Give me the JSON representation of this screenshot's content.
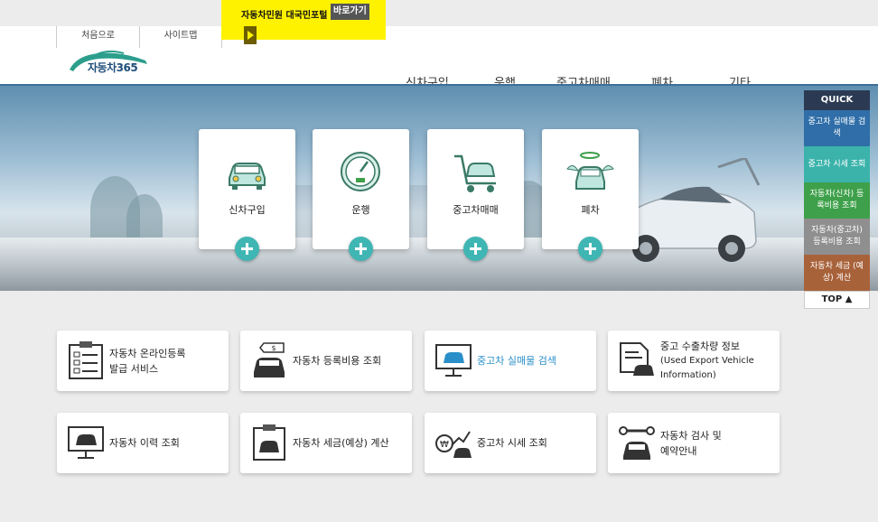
{
  "utility": {
    "home": "처음으로",
    "sitemap": "사이트맵"
  },
  "promo": {
    "text": "자동차민원 대국민포털",
    "button": "바로가기"
  },
  "logo": {
    "text": "자동차365"
  },
  "gnb": [
    "신차구입",
    "운행",
    "중고차매매",
    "폐차",
    "기타"
  ],
  "cards": [
    {
      "label": "신차구입",
      "icon": "new-car-icon"
    },
    {
      "label": "운행",
      "icon": "speedometer-icon"
    },
    {
      "label": "중고차매매",
      "icon": "cart-car-icon"
    },
    {
      "label": "폐차",
      "icon": "angel-car-icon"
    }
  ],
  "quick": {
    "title": "QUICK",
    "items": [
      {
        "label": "중고차 실매물 검색",
        "color": "#2f6ea8"
      },
      {
        "label": "중고차 시세 조회",
        "color": "#3bb3ab"
      },
      {
        "label": "자동차(신차) 등록비용 조회",
        "color": "#3ea04a"
      },
      {
        "label": "자동차(중고차) 등록비용 조회",
        "color": "#8f8f8f"
      },
      {
        "label": "자동차 세금 (예상) 계산",
        "color": "#a8623a"
      }
    ],
    "top": "TOP ▲"
  },
  "services": [
    {
      "line1": "자동차 온라인등록",
      "line2": "발급 서비스",
      "icon": "checklist-icon"
    },
    {
      "line1": "자동차 등록비용 조회",
      "line2": "",
      "icon": "car-price-tag-icon"
    },
    {
      "line1": "중고차 실매물 검색",
      "line2": "",
      "icon": "monitor-car-icon",
      "active": true
    },
    {
      "line1": "중고 수출차량 정보",
      "line2": "(Used Export Vehicle Information)",
      "icon": "document-car-icon"
    },
    {
      "line1": "자동차 이력 조회",
      "line2": "",
      "icon": "monitor-history-icon"
    },
    {
      "line1": "자동차 세금(예상) 계산",
      "line2": "",
      "icon": "clipboard-car-icon"
    },
    {
      "line1": "중고차 시세 조회",
      "line2": "",
      "icon": "won-chart-icon"
    },
    {
      "line1": "자동차 검사 및",
      "line2": "예약안내",
      "icon": "wrench-car-icon"
    }
  ]
}
